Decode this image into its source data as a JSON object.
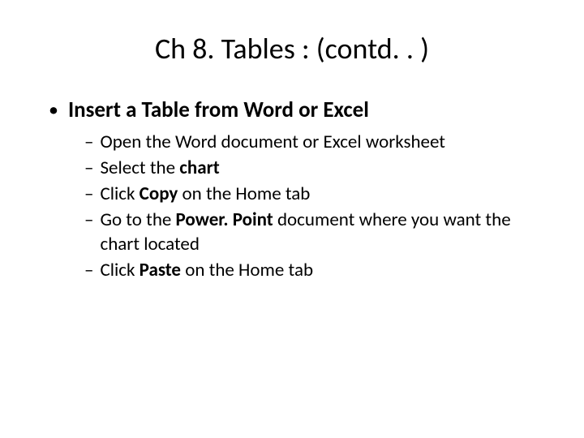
{
  "title": "Ch 8. Tables : (contd. . )",
  "main_bullet": "Insert a Table from Word or Excel",
  "sub": {
    "s0": {
      "t0": "Open the Word document or Excel worksheet"
    },
    "s1": {
      "t0": "Select the ",
      "b0": "chart"
    },
    "s2": {
      "t0": "Click ",
      "b0": "Copy",
      "t1": " on the Home tab"
    },
    "s3": {
      "t0": "Go to the ",
      "b0": "Power. Point",
      "t1": " document where you want the chart located"
    },
    "s4": {
      "t0": "Click ",
      "b0": "Paste",
      "t1": " on the Home tab"
    }
  }
}
